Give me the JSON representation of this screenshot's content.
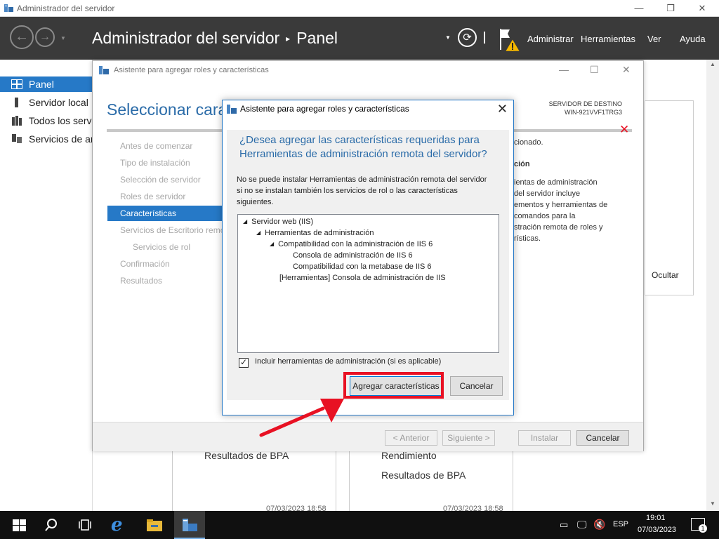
{
  "window": {
    "title": "Administrador del servidor",
    "controls": {
      "minimize": "—",
      "restore": "❐",
      "close": "✕"
    }
  },
  "header": {
    "back_icon": "←",
    "forward_icon": "→",
    "breadcrumb_root": "Administrador del servidor",
    "breadcrumb_sep": "▸",
    "breadcrumb_page": "Panel",
    "menu": [
      "Administrar",
      "Herramientas",
      "Ver",
      "Ayuda"
    ]
  },
  "sidebar": {
    "items": [
      {
        "label": "Panel",
        "icon": "dashboard-icon"
      },
      {
        "label": "Servidor local",
        "icon": "server-icon"
      },
      {
        "label": "Todos los servidores",
        "icon": "servers-icon"
      },
      {
        "label": "Servicios de archivos y de almacenamiento",
        "icon": "storage-icon"
      }
    ]
  },
  "background": {
    "bpa1": "Resultados de BPA",
    "rendimiento": "Rendimiento",
    "bpa2": "Resultados de BPA",
    "date1": "07/03/2023 18:58",
    "date2": "07/03/2023 18:58"
  },
  "wizard": {
    "title": "Asistente para agregar roles y características",
    "heading": "Seleccionar características",
    "dest_label": "SERVIDOR DE DESTINO",
    "dest_server": "WIN-921VVF1TRG3",
    "steps": [
      "Antes de comenzar",
      "Tipo de instalación",
      "Selección de servidor",
      "Roles de servidor",
      "Características",
      "Servicios de Escritorio remoto",
      "Servicios de rol",
      "Confirmación",
      "Resultados"
    ],
    "active_step": 4,
    "desc_selected": "cionado.",
    "desc_title": "ción",
    "desc_lines": [
      "ientas de administración",
      "del servidor incluye",
      "ementos y herramientas de",
      "comandos para la",
      "stración remota de roles y",
      "rísticas."
    ],
    "hide_label": "Ocultar",
    "buttons": {
      "prev": "< Anterior",
      "next": "Siguiente >",
      "install": "Instalar",
      "cancel": "Cancelar"
    }
  },
  "dialog": {
    "title": "Asistente para agregar roles y características",
    "question": "¿Desea agregar las características requeridas para Herramientas de administración remota del servidor?",
    "message": "No se puede instalar Herramientas de administración remota del servidor si no se instalan también los servicios de rol o las características siguientes.",
    "tree": [
      {
        "label": "Servidor web (IIS)",
        "level": 0,
        "expanded": true
      },
      {
        "label": "Herramientas de administración",
        "level": 1,
        "expanded": true
      },
      {
        "label": "Compatibilidad con la administración de IIS 6",
        "level": 2,
        "expanded": true
      },
      {
        "label": "Consola de administración de IIS 6",
        "level": 3,
        "expanded": false
      },
      {
        "label": "Compatibilidad con la metabase de IIS 6",
        "level": 3,
        "expanded": false
      },
      {
        "label": "[Herramientas] Consola de administración de IIS",
        "level": 2,
        "expanded": false
      }
    ],
    "checkbox_label": "Incluir herramientas de administración (si es aplicable)",
    "checkbox_checked": true,
    "add_button": "Agregar características",
    "cancel_button": "Cancelar"
  },
  "taskbar": {
    "lang": "ESP",
    "time": "19:01",
    "date": "07/03/2023",
    "notifications": "1"
  },
  "colors": {
    "accent": "#2679c7",
    "header_bg": "#3a3a3a",
    "highlight": "#e81123",
    "heading_blue": "#2a6ba8"
  }
}
